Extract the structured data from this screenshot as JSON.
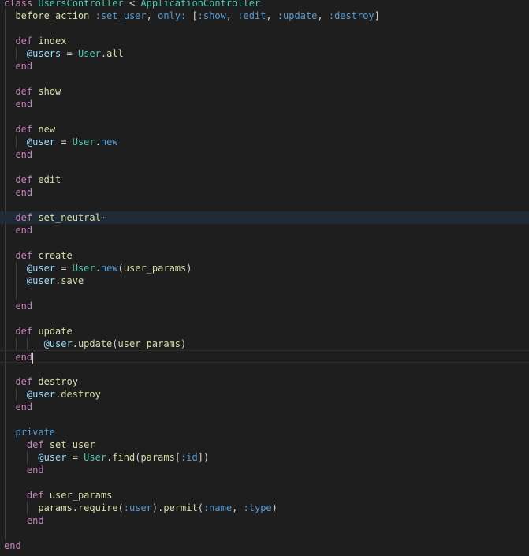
{
  "editor": {
    "language": "ruby",
    "fold_marker": "⋯",
    "lines": [
      [
        {
          "t": "class",
          "c": "kw"
        },
        {
          "t": " "
        },
        {
          "t": "UsersController",
          "c": "cls"
        },
        {
          "t": " < "
        },
        {
          "t": "ApplicationController",
          "c": "cls"
        }
      ],
      [
        {
          "t": "  before_action",
          "c": "fn"
        },
        {
          "t": " "
        },
        {
          "t": ":set_user",
          "c": "sym"
        },
        {
          "t": ", "
        },
        {
          "t": "only:",
          "c": "sym"
        },
        {
          "t": " ["
        },
        {
          "t": ":show",
          "c": "sym"
        },
        {
          "t": ", "
        },
        {
          "t": ":edit",
          "c": "sym"
        },
        {
          "t": ", "
        },
        {
          "t": ":update",
          "c": "sym"
        },
        {
          "t": ", "
        },
        {
          "t": ":destroy",
          "c": "sym"
        },
        {
          "t": "]"
        }
      ],
      [],
      [
        {
          "t": "  "
        },
        {
          "t": "def",
          "c": "kw"
        },
        {
          "t": " "
        },
        {
          "t": "index",
          "c": "fn"
        }
      ],
      [
        {
          "t": "    "
        },
        {
          "t": "@users",
          "c": "ivar"
        },
        {
          "t": " = "
        },
        {
          "t": "User",
          "c": "cls"
        },
        {
          "t": "."
        },
        {
          "t": "all",
          "c": "fn"
        }
      ],
      [
        {
          "t": "  "
        },
        {
          "t": "end",
          "c": "kw"
        }
      ],
      [],
      [
        {
          "t": "  "
        },
        {
          "t": "def",
          "c": "kw"
        },
        {
          "t": " "
        },
        {
          "t": "show",
          "c": "fn"
        }
      ],
      [
        {
          "t": "  "
        },
        {
          "t": "end",
          "c": "kw"
        }
      ],
      [],
      [
        {
          "t": "  "
        },
        {
          "t": "def",
          "c": "kw"
        },
        {
          "t": " "
        },
        {
          "t": "new",
          "c": "fn"
        }
      ],
      [
        {
          "t": "    "
        },
        {
          "t": "@user",
          "c": "ivar"
        },
        {
          "t": " = "
        },
        {
          "t": "User",
          "c": "cls"
        },
        {
          "t": "."
        },
        {
          "t": "new",
          "c": "kw2"
        }
      ],
      [
        {
          "t": "  "
        },
        {
          "t": "end",
          "c": "kw"
        }
      ],
      [],
      [
        {
          "t": "  "
        },
        {
          "t": "def",
          "c": "kw"
        },
        {
          "t": " "
        },
        {
          "t": "edit",
          "c": "fn"
        }
      ],
      [
        {
          "t": "  "
        },
        {
          "t": "end",
          "c": "kw"
        }
      ],
      [],
      [
        {
          "t": "  "
        },
        {
          "t": "def",
          "c": "kw"
        },
        {
          "t": " "
        },
        {
          "t": "set_neutral",
          "c": "fn"
        },
        {
          "t": "⋯",
          "c": "fold"
        }
      ],
      [
        {
          "t": "  "
        },
        {
          "t": "end",
          "c": "kw"
        }
      ],
      [],
      [
        {
          "t": "  "
        },
        {
          "t": "def",
          "c": "kw"
        },
        {
          "t": " "
        },
        {
          "t": "create",
          "c": "fn"
        }
      ],
      [
        {
          "t": "    "
        },
        {
          "t": "@user",
          "c": "ivar"
        },
        {
          "t": " = "
        },
        {
          "t": "User",
          "c": "cls"
        },
        {
          "t": "."
        },
        {
          "t": "new",
          "c": "kw2"
        },
        {
          "t": "("
        },
        {
          "t": "user_params",
          "c": "fn"
        },
        {
          "t": ")"
        }
      ],
      [
        {
          "t": "    "
        },
        {
          "t": "@user",
          "c": "ivar"
        },
        {
          "t": "."
        },
        {
          "t": "save",
          "c": "fn"
        }
      ],
      [],
      [
        {
          "t": "  "
        },
        {
          "t": "end",
          "c": "kw"
        }
      ],
      [],
      [
        {
          "t": "  "
        },
        {
          "t": "def",
          "c": "kw"
        },
        {
          "t": " "
        },
        {
          "t": "update",
          "c": "fn"
        }
      ],
      [
        {
          "t": "       "
        },
        {
          "t": "@user",
          "c": "ivar"
        },
        {
          "t": "."
        },
        {
          "t": "update",
          "c": "fn"
        },
        {
          "t": "("
        },
        {
          "t": "user_params",
          "c": "fn"
        },
        {
          "t": ")"
        }
      ],
      [
        {
          "t": "  "
        },
        {
          "t": "end",
          "c": "kw"
        }
      ],
      [],
      [
        {
          "t": "  "
        },
        {
          "t": "def",
          "c": "kw"
        },
        {
          "t": " "
        },
        {
          "t": "destroy",
          "c": "fn"
        }
      ],
      [
        {
          "t": "    "
        },
        {
          "t": "@user",
          "c": "ivar"
        },
        {
          "t": "."
        },
        {
          "t": "destroy",
          "c": "fn"
        }
      ],
      [
        {
          "t": "  "
        },
        {
          "t": "end",
          "c": "kw"
        }
      ],
      [],
      [
        {
          "t": "  "
        },
        {
          "t": "private",
          "c": "kw2"
        }
      ],
      [
        {
          "t": "    "
        },
        {
          "t": "def",
          "c": "kw"
        },
        {
          "t": " "
        },
        {
          "t": "set_user",
          "c": "fn"
        }
      ],
      [
        {
          "t": "      "
        },
        {
          "t": "@user",
          "c": "ivar"
        },
        {
          "t": " = "
        },
        {
          "t": "User",
          "c": "cls"
        },
        {
          "t": "."
        },
        {
          "t": "find",
          "c": "fn"
        },
        {
          "t": "("
        },
        {
          "t": "params",
          "c": "fn"
        },
        {
          "t": "["
        },
        {
          "t": ":id",
          "c": "sym"
        },
        {
          "t": "])"
        }
      ],
      [
        {
          "t": "    "
        },
        {
          "t": "end",
          "c": "kw"
        }
      ],
      [],
      [
        {
          "t": "    "
        },
        {
          "t": "def",
          "c": "kw"
        },
        {
          "t": " "
        },
        {
          "t": "user_params",
          "c": "fn"
        }
      ],
      [
        {
          "t": "      "
        },
        {
          "t": "params",
          "c": "fn"
        },
        {
          "t": "."
        },
        {
          "t": "require",
          "c": "fn"
        },
        {
          "t": "("
        },
        {
          "t": ":user",
          "c": "sym"
        },
        {
          "t": ")."
        },
        {
          "t": "permit",
          "c": "fn"
        },
        {
          "t": "("
        },
        {
          "t": ":name",
          "c": "sym"
        },
        {
          "t": ", "
        },
        {
          "t": ":type",
          "c": "sym"
        },
        {
          "t": ")"
        }
      ],
      [
        {
          "t": "    "
        },
        {
          "t": "end",
          "c": "kw"
        }
      ],
      [],
      [
        {
          "t": "end",
          "c": "kw"
        }
      ]
    ],
    "folded_line_index": 17,
    "cursor_line_index": 28
  }
}
